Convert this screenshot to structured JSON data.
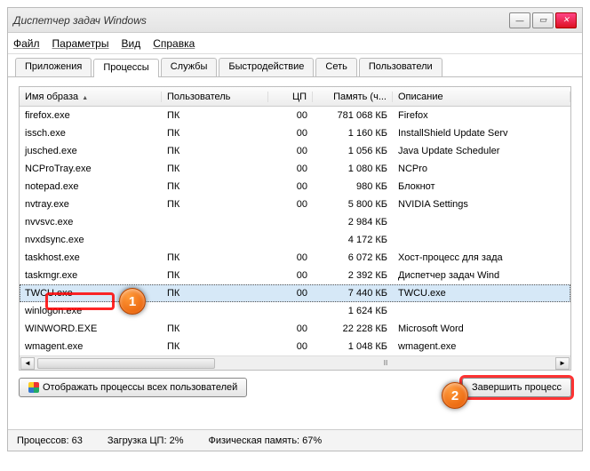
{
  "window": {
    "title": "Диспетчер задач Windows"
  },
  "menu": {
    "file": "Файл",
    "options": "Параметры",
    "view": "Вид",
    "help": "Справка"
  },
  "tabs": {
    "apps": "Приложения",
    "procs": "Процессы",
    "services": "Службы",
    "perf": "Быстродействие",
    "net": "Сеть",
    "users": "Пользователи"
  },
  "columns": {
    "image": "Имя образа",
    "user": "Пользователь",
    "cpu": "ЦП",
    "memory": "Память (ч...",
    "desc": "Описание"
  },
  "rows": [
    {
      "image": "firefox.exe",
      "user": "ПК",
      "cpu": "00",
      "mem": "781 068 КБ",
      "desc": "Firefox"
    },
    {
      "image": "issch.exe",
      "user": "ПК",
      "cpu": "00",
      "mem": "1 160 КБ",
      "desc": "InstallShield Update Serv"
    },
    {
      "image": "jusched.exe",
      "user": "ПК",
      "cpu": "00",
      "mem": "1 056 КБ",
      "desc": "Java Update Scheduler"
    },
    {
      "image": "NCProTray.exe",
      "user": "ПК",
      "cpu": "00",
      "mem": "1 080 КБ",
      "desc": "NCPro"
    },
    {
      "image": "notepad.exe",
      "user": "ПК",
      "cpu": "00",
      "mem": "980 КБ",
      "desc": "Блокнот"
    },
    {
      "image": "nvtray.exe",
      "user": "ПК",
      "cpu": "00",
      "mem": "5 800 КБ",
      "desc": "NVIDIA Settings"
    },
    {
      "image": "nvvsvc.exe",
      "user": "",
      "cpu": "",
      "mem": "2 984 КБ",
      "desc": ""
    },
    {
      "image": "nvxdsync.exe",
      "user": "",
      "cpu": "",
      "mem": "4 172 КБ",
      "desc": ""
    },
    {
      "image": "taskhost.exe",
      "user": "ПК",
      "cpu": "00",
      "mem": "6 072 КБ",
      "desc": "Хост-процесс для зада"
    },
    {
      "image": "taskmgr.exe",
      "user": "ПК",
      "cpu": "00",
      "mem": "2 392 КБ",
      "desc": "Диспетчер задач Wind"
    },
    {
      "image": "TWCU.exe",
      "user": "ПК",
      "cpu": "00",
      "mem": "7 440 КБ",
      "desc": "TWCU.exe",
      "selected": true
    },
    {
      "image": "winlogon.exe",
      "user": "",
      "cpu": "",
      "mem": "1 624 КБ",
      "desc": ""
    },
    {
      "image": "WINWORD.EXE",
      "user": "ПК",
      "cpu": "00",
      "mem": "22 228 КБ",
      "desc": "Microsoft Word"
    },
    {
      "image": "wmagent.exe",
      "user": "ПК",
      "cpu": "00",
      "mem": "1 048 КБ",
      "desc": "wmagent.exe"
    }
  ],
  "buttons": {
    "show_all": "Отображать процессы всех пользователей",
    "end": "Завершить процесс"
  },
  "status": {
    "procs": "Процессов: 63",
    "cpu": "Загрузка ЦП: 2%",
    "mem": "Физическая память: 67%"
  },
  "callouts": {
    "one": "1",
    "two": "2"
  }
}
